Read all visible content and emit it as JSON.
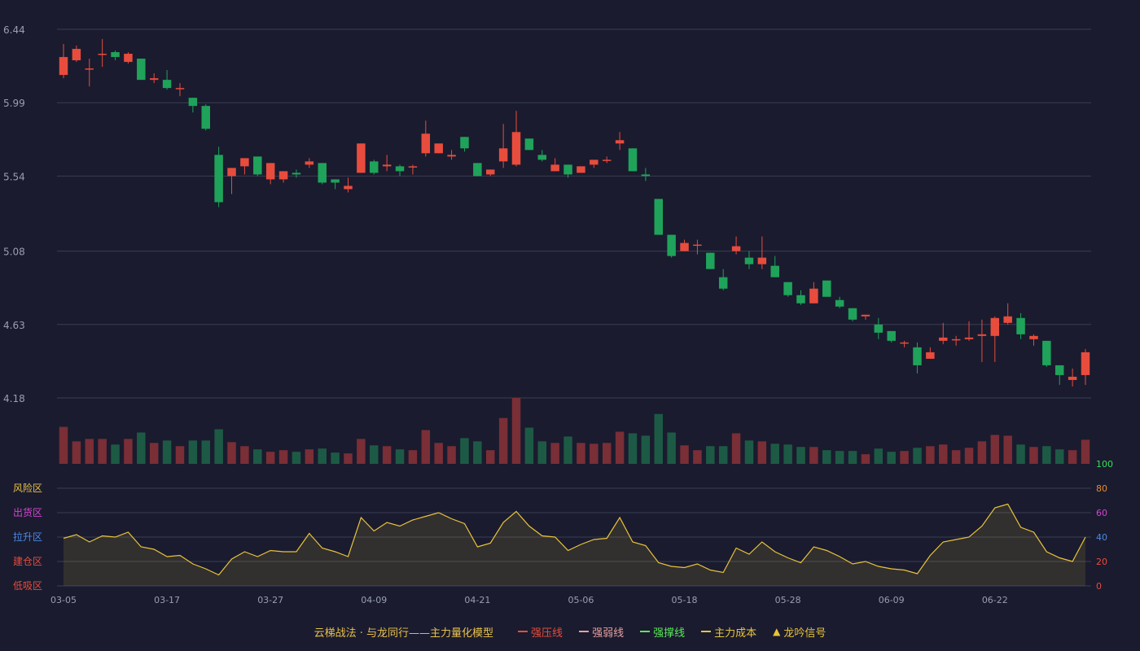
{
  "colors": {
    "background": "#1a1b2e",
    "grid": "#3a3d52",
    "up": "#e84c3d",
    "down": "#1fa35a",
    "line": "#e8c33a",
    "axis_text": "#9a9fb0"
  },
  "chart_data": [
    {
      "type": "candlestick",
      "ylim": [
        4.18,
        6.44
      ],
      "y_ticks": [
        "6.44",
        "5.99",
        "5.54",
        "5.08",
        "4.63",
        "4.18"
      ],
      "x_ticks": [
        "03-05",
        "03-17",
        "03-27",
        "04-09",
        "04-21",
        "05-06",
        "05-18",
        "05-28",
        "06-09",
        "06-22"
      ],
      "x_tick_index": [
        0,
        8,
        16,
        24,
        32,
        40,
        48,
        56,
        64,
        72
      ],
      "ohlc": [
        [
          6.16,
          6.27,
          6.14,
          6.35
        ],
        [
          6.25,
          6.32,
          6.24,
          6.34
        ],
        [
          6.2,
          6.2,
          6.09,
          6.26
        ],
        [
          6.29,
          6.29,
          6.21,
          6.38
        ],
        [
          6.3,
          6.27,
          6.25,
          6.31
        ],
        [
          6.24,
          6.29,
          6.23,
          6.3
        ],
        [
          6.26,
          6.13,
          6.13,
          6.26
        ],
        [
          6.13,
          6.14,
          6.11,
          6.17
        ],
        [
          6.13,
          6.08,
          6.07,
          6.19
        ],
        [
          6.08,
          6.08,
          6.03,
          6.11
        ],
        [
          6.02,
          5.97,
          5.93,
          6.02
        ],
        [
          5.97,
          5.83,
          5.82,
          5.98
        ],
        [
          5.67,
          5.38,
          5.35,
          5.72
        ],
        [
          5.54,
          5.59,
          5.43,
          5.59
        ],
        [
          5.6,
          5.65,
          5.55,
          5.63
        ],
        [
          5.66,
          5.55,
          5.54,
          5.66
        ],
        [
          5.52,
          5.62,
          5.49,
          5.62
        ],
        [
          5.52,
          5.57,
          5.5,
          5.57
        ],
        [
          5.56,
          5.55,
          5.53,
          5.58
        ],
        [
          5.61,
          5.63,
          5.59,
          5.65
        ],
        [
          5.62,
          5.5,
          5.49,
          5.62
        ],
        [
          5.52,
          5.5,
          5.46,
          5.52
        ],
        [
          5.46,
          5.48,
          5.44,
          5.53
        ],
        [
          5.56,
          5.74,
          5.56,
          5.74
        ],
        [
          5.63,
          5.56,
          5.55,
          5.64
        ],
        [
          5.6,
          5.61,
          5.57,
          5.67
        ],
        [
          5.6,
          5.57,
          5.54,
          5.61
        ],
        [
          5.6,
          5.6,
          5.55,
          5.61
        ],
        [
          5.68,
          5.8,
          5.66,
          5.88
        ],
        [
          5.68,
          5.74,
          5.68,
          5.74
        ],
        [
          5.66,
          5.67,
          5.64,
          5.7
        ],
        [
          5.78,
          5.71,
          5.69,
          5.78
        ],
        [
          5.62,
          5.54,
          5.54,
          5.62
        ],
        [
          5.55,
          5.58,
          5.54,
          5.58
        ],
        [
          5.63,
          5.71,
          5.59,
          5.86
        ],
        [
          5.61,
          5.81,
          5.6,
          5.94
        ],
        [
          5.77,
          5.7,
          5.7,
          5.77
        ],
        [
          5.67,
          5.64,
          5.63,
          5.7
        ],
        [
          5.57,
          5.61,
          5.57,
          5.65
        ],
        [
          5.61,
          5.55,
          5.53,
          5.61
        ],
        [
          5.56,
          5.6,
          5.56,
          5.6
        ],
        [
          5.61,
          5.64,
          5.59,
          5.64
        ],
        [
          5.64,
          5.64,
          5.62,
          5.66
        ],
        [
          5.74,
          5.76,
          5.7,
          5.81
        ],
        [
          5.71,
          5.57,
          5.57,
          5.71
        ],
        [
          5.55,
          5.54,
          5.51,
          5.59
        ],
        [
          5.4,
          5.18,
          5.18,
          5.4
        ],
        [
          5.18,
          5.05,
          5.04,
          5.18
        ],
        [
          5.08,
          5.13,
          5.08,
          5.15
        ],
        [
          5.12,
          5.12,
          5.06,
          5.15
        ],
        [
          5.07,
          4.97,
          4.97,
          5.07
        ],
        [
          4.92,
          4.85,
          4.84,
          4.97
        ],
        [
          5.08,
          5.11,
          5.06,
          5.17
        ],
        [
          5.04,
          5.0,
          4.97,
          5.08
        ],
        [
          5.0,
          5.04,
          4.97,
          5.17
        ],
        [
          4.99,
          4.92,
          4.92,
          5.05
        ],
        [
          4.89,
          4.81,
          4.8,
          4.89
        ],
        [
          4.81,
          4.76,
          4.75,
          4.84
        ],
        [
          4.76,
          4.85,
          4.76,
          4.89
        ],
        [
          4.9,
          4.8,
          4.8,
          4.89
        ],
        [
          4.78,
          4.74,
          4.73,
          4.8
        ],
        [
          4.73,
          4.66,
          4.65,
          4.73
        ],
        [
          4.68,
          4.69,
          4.66,
          4.69
        ],
        [
          4.63,
          4.58,
          4.54,
          4.67
        ],
        [
          4.59,
          4.53,
          4.52,
          4.59
        ],
        [
          4.52,
          4.52,
          4.49,
          4.53
        ],
        [
          4.49,
          4.38,
          4.33,
          4.52
        ],
        [
          4.42,
          4.46,
          4.42,
          4.49
        ],
        [
          4.53,
          4.55,
          4.51,
          4.64
        ],
        [
          4.54,
          4.54,
          4.5,
          4.56
        ],
        [
          4.54,
          4.55,
          4.53,
          4.65
        ],
        [
          4.56,
          4.57,
          4.4,
          4.66
        ],
        [
          4.56,
          4.67,
          4.4,
          4.68
        ],
        [
          4.64,
          4.68,
          4.63,
          4.76
        ],
        [
          4.67,
          4.57,
          4.54,
          4.7
        ],
        [
          4.54,
          4.56,
          4.5,
          4.57
        ],
        [
          4.53,
          4.38,
          4.37,
          4.53
        ],
        [
          4.38,
          4.32,
          4.26,
          4.38
        ],
        [
          4.29,
          4.31,
          4.25,
          4.36
        ],
        [
          4.32,
          4.46,
          4.26,
          4.48
        ]
      ]
    },
    {
      "type": "bar",
      "name": "volume",
      "values": [
        46,
        28,
        31,
        31,
        24,
        31,
        39,
        26,
        29,
        22,
        29,
        29,
        43,
        27,
        22,
        18,
        15,
        17,
        15,
        18,
        19,
        14,
        13,
        31,
        23,
        22,
        18,
        17,
        42,
        26,
        22,
        32,
        28,
        17,
        57,
        82,
        45,
        28,
        26,
        34,
        26,
        25,
        26,
        40,
        38,
        35,
        62,
        39,
        23,
        17,
        22,
        22,
        38,
        29,
        28,
        25,
        24,
        21,
        21,
        17,
        16,
        16,
        12,
        19,
        15,
        16,
        20,
        22,
        24,
        17,
        20,
        28,
        36,
        35,
        24,
        21,
        22,
        18,
        17,
        30
      ],
      "colors_up": "#7a2e36",
      "colors_down": "#1d5a45"
    },
    {
      "type": "area",
      "ylim": [
        0,
        100
      ],
      "y_ticks": [
        "100",
        "80",
        "60",
        "40",
        "20",
        "0"
      ],
      "zone_labels": [
        "风险区",
        "出货区",
        "拉升区",
        "建仓区",
        "低吸区"
      ],
      "zone_colors": [
        "#e8c04a",
        "#d444d4",
        "#4a8ae8",
        "#e84c3d",
        "#e84c3d"
      ],
      "tick_colors": [
        "#3adc5a",
        "#e88a2a",
        "#d444d4",
        "#4a8ae8",
        "#e84c3d",
        "#e84c3d"
      ],
      "values": [
        39,
        42,
        36,
        41,
        40,
        44,
        32,
        30,
        24,
        25,
        18,
        14,
        9,
        22,
        28,
        24,
        29,
        28,
        28,
        43,
        31,
        28,
        24,
        56,
        45,
        52,
        49,
        54,
        57,
        60,
        55,
        51,
        32,
        35,
        52,
        61,
        49,
        41,
        40,
        29,
        34,
        38,
        39,
        56,
        36,
        33,
        19,
        16,
        15,
        18,
        13,
        11,
        31,
        26,
        36,
        28,
        23,
        19,
        32,
        29,
        24,
        18,
        20,
        16,
        14,
        13,
        10,
        25,
        36,
        38,
        40,
        49,
        64,
        67,
        48,
        44,
        28,
        23,
        20,
        40
      ]
    }
  ],
  "legend": {
    "title": "云梯战法 · 与龙同行——主力量化模型",
    "items": [
      {
        "label": "强压线",
        "color": "#e84c3d",
        "style": "solid"
      },
      {
        "label": "强弱线",
        "color": "#e8a0a0",
        "style": "dashed"
      },
      {
        "label": "强撑线",
        "color": "#5ae85a",
        "style": "solid"
      },
      {
        "label": "主力成本",
        "color": "#e8c33a",
        "style": "dashed"
      },
      {
        "label": "龙吟信号",
        "color": "#e8c33a",
        "style": "triangle"
      }
    ]
  }
}
